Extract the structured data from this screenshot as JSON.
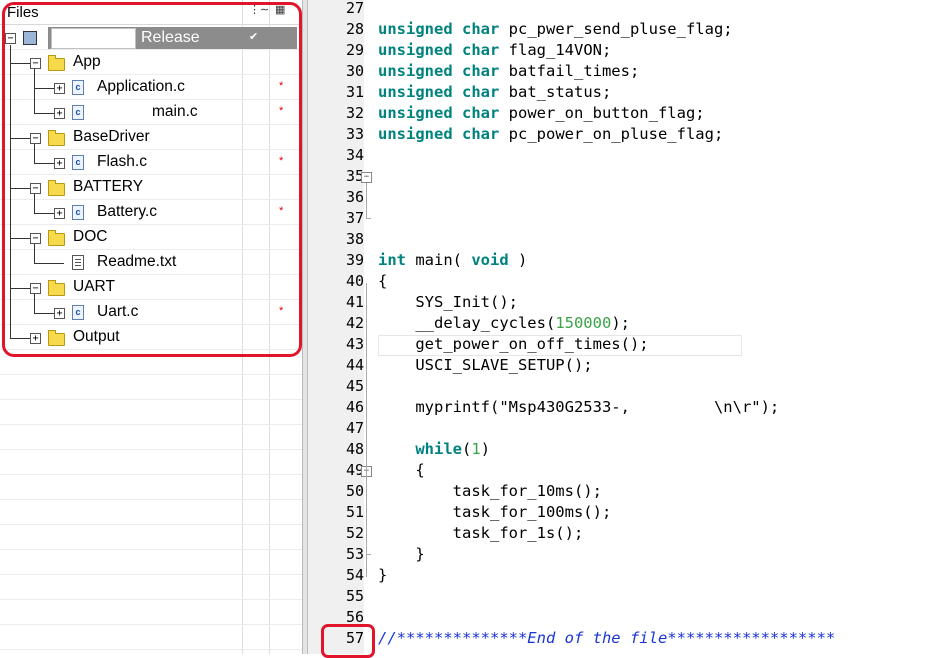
{
  "files_pane": {
    "title": "Files",
    "config": "Release",
    "header_icons": [
      "settings-columns-icon",
      "make-icon"
    ],
    "tree": [
      {
        "label": "App",
        "type": "folder",
        "expander": "−"
      },
      {
        "label": "Application.c",
        "type": "c-file",
        "expander": "+",
        "modified": "*"
      },
      {
        "label": "main.c",
        "type": "c-file",
        "expander": "+",
        "modified": "*"
      },
      {
        "label": "BaseDriver",
        "type": "folder",
        "expander": "−"
      },
      {
        "label": "Flash.c",
        "type": "c-file",
        "expander": "+",
        "modified": "*"
      },
      {
        "label": "BATTERY",
        "type": "folder",
        "expander": "−"
      },
      {
        "label": "Battery.c",
        "type": "c-file",
        "expander": "+",
        "modified": "*"
      },
      {
        "label": "DOC",
        "type": "folder",
        "expander": "−"
      },
      {
        "label": "Readme.txt",
        "type": "text-file"
      },
      {
        "label": "UART",
        "type": "folder",
        "expander": "−"
      },
      {
        "label": "Uart.c",
        "type": "c-file",
        "expander": "+",
        "modified": "*"
      },
      {
        "label": "Output",
        "type": "folder",
        "expander": "+"
      }
    ],
    "root_expander": "−"
  },
  "editor": {
    "lines": [
      {
        "n": "27",
        "code": ""
      },
      {
        "n": "28",
        "code": "unsigned char pc_pwer_send_pluse_flag;"
      },
      {
        "n": "29",
        "code": "unsigned char flag_14VON;"
      },
      {
        "n": "30",
        "code": "unsigned char batfail_times;"
      },
      {
        "n": "31",
        "code": "unsigned char bat_status;"
      },
      {
        "n": "32",
        "code": "unsigned char power_on_button_flag;"
      },
      {
        "n": "33",
        "code": "unsigned char pc_power_on_pluse_flag;"
      },
      {
        "n": "34",
        "code": ""
      },
      {
        "n": "35",
        "code": ""
      },
      {
        "n": "36",
        "code": ""
      },
      {
        "n": "37",
        "code": ""
      },
      {
        "n": "38",
        "code": ""
      },
      {
        "n": "39",
        "code": "int main( void )"
      },
      {
        "n": "40",
        "code": "{"
      },
      {
        "n": "41",
        "code": "    SYS_Init();"
      },
      {
        "n": "42",
        "code": "    __delay_cycles(150000);"
      },
      {
        "n": "43",
        "code": "    get_power_on_off_times();"
      },
      {
        "n": "44",
        "code": "    USCI_SLAVE_SETUP();"
      },
      {
        "n": "45",
        "code": ""
      },
      {
        "n": "46",
        "code": "    myprintf(\"Msp430G2533-,         \\n\\r\");"
      },
      {
        "n": "47",
        "code": ""
      },
      {
        "n": "48",
        "code": "    while(1)"
      },
      {
        "n": "49",
        "code": "    {"
      },
      {
        "n": "50",
        "code": "        task_for_10ms();"
      },
      {
        "n": "51",
        "code": "        task_for_100ms();"
      },
      {
        "n": "52",
        "code": "        task_for_1s();"
      },
      {
        "n": "53",
        "code": "    }"
      },
      {
        "n": "54",
        "code": "}"
      },
      {
        "n": "55",
        "code": ""
      },
      {
        "n": "56",
        "code": ""
      },
      {
        "n": "57",
        "code": "//**************End of the file******************"
      }
    ]
  },
  "colors": {
    "keyword": "#00837e",
    "number": "#3aa346",
    "comment": "#1a35d6",
    "highlight": "#e0142b"
  }
}
